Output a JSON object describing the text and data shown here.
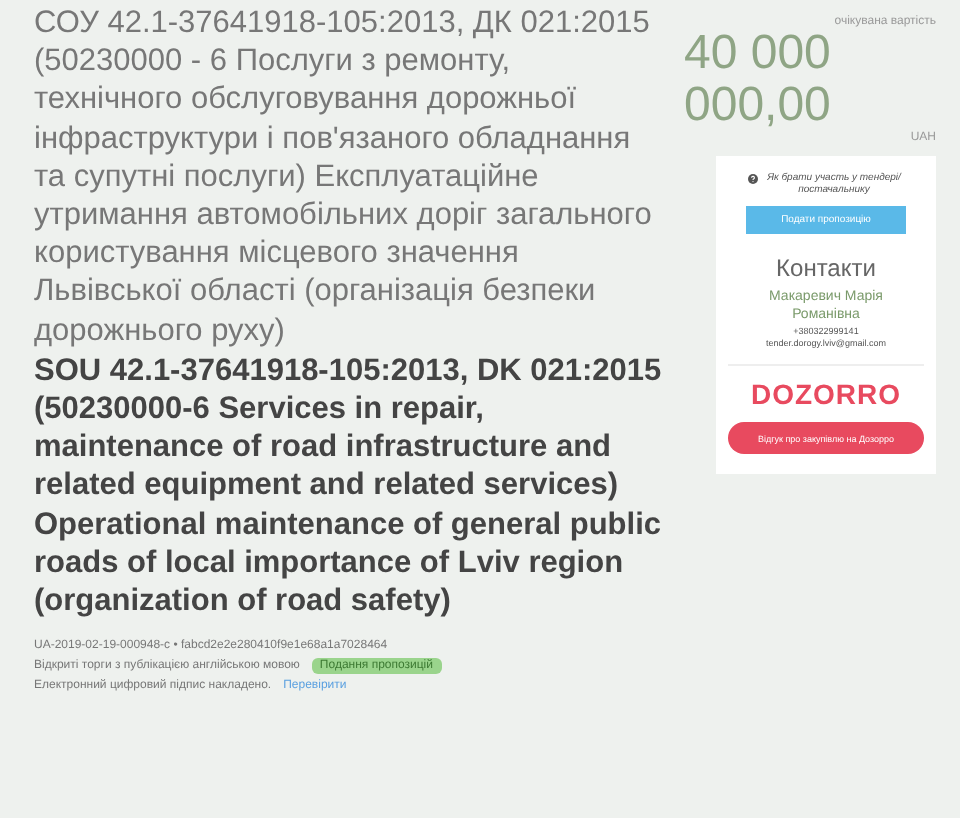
{
  "title_uk": "СОУ 42.1-37641918-105:2013, ДК 021:2015 (50230000 - 6 Послуги з ремонту, технічного обслуговування дорожньої інфраструктури і пов'язаного обладнання та супутні послуги) Експлуатаційне утримання автомобільних доріг загального користування місцевого значення Львівської області (організація безпеки дорожнього руху)",
  "title_en": "SOU 42.1-37641918-105:2013, DK 021:2015 (50230000-6 Services in repair, maintenance of road infrastructure and related equipment and related services) Operational maintenance of general public roads of local importance of Lviv region (organization of road safety)",
  "meta": {
    "id_line": "UA-2019-02-19-000948-c • fabcd2e2e280410f9e1e68a1a7028464",
    "procedure": "Відкриті торги з публікацією англійською мовою",
    "status_badge": "Подання пропозицій",
    "signature": "Електронний цифровий підпис накладено.",
    "verify_link": "Перевірити"
  },
  "budget": {
    "label": "очікувана вартість",
    "amount": "40 000 000,00",
    "currency": "UAH"
  },
  "sidebar": {
    "help_link": "Як брати участь у тендері/ постачальнику",
    "submit_button": "Подати пропозицію",
    "contacts_title": "Контакти",
    "contact_name": "Макаревич Марія Романівна",
    "phone": "+380322999141",
    "email": "tender.dorogy.lviv@gmail.com",
    "logo": "DOZORRO",
    "feedback_button": "Відгук про закупівлю на Дозорро"
  }
}
